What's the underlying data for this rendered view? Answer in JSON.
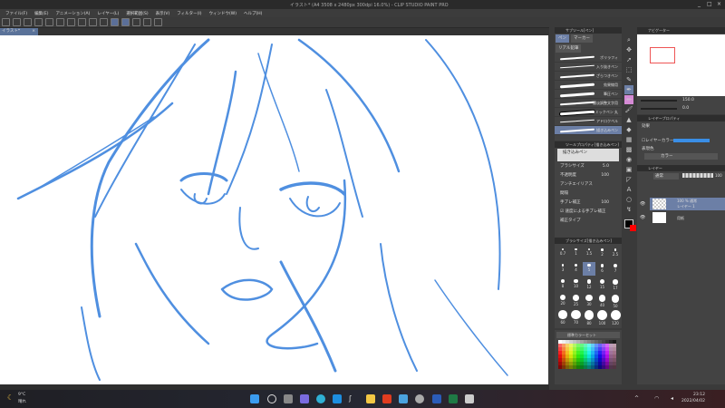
{
  "window": {
    "title": "イラスト* (A4 3508 x 2480px 300dpi 16.0%) - CLIP STUDIO PAINT PRO",
    "minimize": "_",
    "maximize": "□",
    "close": "×"
  },
  "menu": [
    "ファイル(F)",
    "編集(E)",
    "アニメーション(A)",
    "レイヤー(L)",
    "選択範囲(S)",
    "表示(V)",
    "フィルター(I)",
    "ウィンドウ(W)",
    "ヘルプ(H)"
  ],
  "document_tab": {
    "label": "イラスト*",
    "close": "×"
  },
  "accent": "#6c7fa6",
  "stroke_color": "#4f8fe0",
  "subtool": {
    "header": "サブツール[ペン]",
    "tabs": [
      "ペン",
      "マーカー",
      "リアル鉛筆"
    ],
    "active_tab": "ペン",
    "brushes": [
      "ポリラフィ",
      "入り抜きペン",
      "ざらつきペン",
      "効果線用",
      "筆圧ペン",
      "濃淡調整文字用",
      "コミックペン 丸",
      "アドロクペル",
      "描き込みペン"
    ],
    "selected": "描き込みペン"
  },
  "tool_property": {
    "header": "ツールプロパティ[描き込みペン]",
    "preset": "描き込みペン",
    "brush_size_label": "ブラシサイズ",
    "brush_size": "5.0",
    "opacity_label": "不透明度",
    "opacity": "100",
    "antialias_label": "アンチエイリアス",
    "spacing_label": "間隔",
    "stabilization_label": "手ブレ補正",
    "stabilization": "100",
    "speed_stabilization_label": "速度による手ブレ補正",
    "speed_stabilization_checked": true,
    "correction_type_label": "補正タイプ"
  },
  "brush_size_panel": {
    "header": "ブラシサイズ[描き込みペン]",
    "sizes": [
      "0.7",
      "1",
      "1.5",
      "2",
      "2.5",
      "3",
      "4",
      "5",
      "6",
      "7",
      "8",
      "10",
      "12",
      "15",
      "17",
      "20",
      "25",
      "30",
      "40",
      "50",
      "60",
      "70",
      "80",
      "100",
      "120"
    ],
    "selected": "5"
  },
  "color_set": {
    "name": "標準カラーセット",
    "main_color": "#000000",
    "sub_color": "#ff0000"
  },
  "navigator": {
    "header": "ナビゲーター",
    "zoom": "150.0",
    "rotation": "0.0"
  },
  "layer_property": {
    "header": "レイヤープロパティ",
    "effect_label": "効果",
    "layer_color_label": "レイヤーカラー",
    "layer_color": "#3a8ee6",
    "expression_label": "表現色",
    "expression_value": "カラー"
  },
  "layers": {
    "header": "レイヤー",
    "blend_mode": "通常",
    "opacity": "100",
    "items": [
      {
        "meta": "100 % 通常",
        "name": "レイヤー 1",
        "selected": true
      },
      {
        "meta": "",
        "name": "用紙",
        "selected": false
      }
    ]
  },
  "taskbar": {
    "temperature": "9°C",
    "weather": "晴れ",
    "time": "23:12",
    "date": "2022/04/02"
  }
}
